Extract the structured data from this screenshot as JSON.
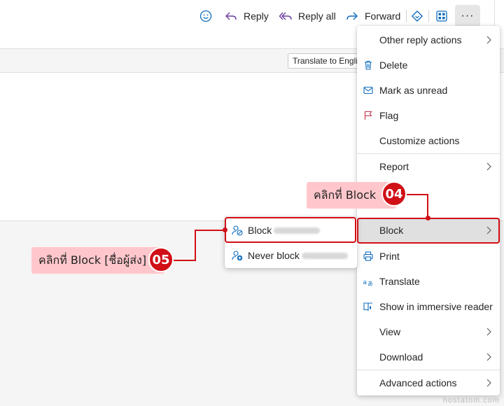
{
  "toolbar": {
    "emoji_icon": "emoji-icon",
    "reply_label": "Reply",
    "reply_all_label": "Reply all",
    "forward_label": "Forward",
    "more_label": "···",
    "accent": "#0f6cbd"
  },
  "reading_pane": {
    "translate_label": "Translate to English"
  },
  "menu": {
    "items": [
      {
        "label": "Other reply actions",
        "icon": "none",
        "submenu": true
      },
      {
        "label": "Delete",
        "icon": "trash-icon",
        "submenu": false
      },
      {
        "label": "Mark as unread",
        "icon": "mail-icon",
        "submenu": false
      },
      {
        "label": "Flag",
        "icon": "flag-icon",
        "submenu": false
      },
      {
        "label": "Customize actions",
        "icon": "none",
        "submenu": false
      },
      {
        "label": "Report",
        "icon": "none",
        "submenu": true
      },
      {
        "label": "Block",
        "icon": "none",
        "submenu": true,
        "active": true
      },
      {
        "label": "Print",
        "icon": "print-icon",
        "submenu": false
      },
      {
        "label": "Translate",
        "icon": "translate-icon",
        "submenu": false
      },
      {
        "label": "Show in immersive reader",
        "icon": "immersive-reader-icon",
        "submenu": false
      },
      {
        "label": "View",
        "icon": "none",
        "submenu": true
      },
      {
        "label": "Download",
        "icon": "none",
        "submenu": true
      },
      {
        "label": "Advanced actions",
        "icon": "none",
        "submenu": true
      }
    ]
  },
  "submenu": {
    "items": [
      {
        "label": "Block",
        "icon": "block-contact-icon",
        "blurred_name": "Partner.info"
      },
      {
        "label": "Never block",
        "icon": "person-add-icon",
        "blurred_name": "Partner.info"
      }
    ]
  },
  "annotations": {
    "step4_text": "คลิกที่ Block",
    "step4_number": "04",
    "step5_text": "คลิกที่ Block [ชื่อผู้ส่ง]",
    "step5_number": "05",
    "color": "#d10f16"
  },
  "watermark": "hostatom.com"
}
